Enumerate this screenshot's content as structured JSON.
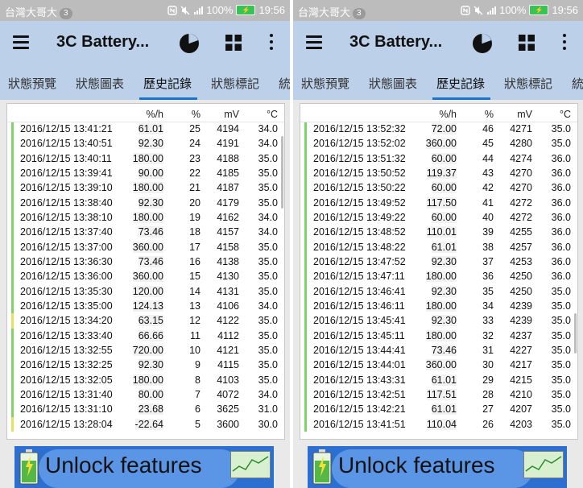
{
  "statusbar": {
    "carrier": "台灣大哥大",
    "notification_count": "3",
    "battery": "100%",
    "time": "19:56"
  },
  "app": {
    "title": "3C Battery...",
    "accent": "#1a73c8",
    "appbar_color": "#bcd0ea"
  },
  "tabs": [
    {
      "label": "狀態預覽",
      "active": false
    },
    {
      "label": "狀態圖表",
      "active": false
    },
    {
      "label": "歷史記錄",
      "active": true
    },
    {
      "label": "狀態標記",
      "active": false
    },
    {
      "label": "統",
      "active": false
    }
  ],
  "table": {
    "columns": [
      "",
      "%/h",
      "%",
      "mV",
      "°C"
    ]
  },
  "left_rows": [
    [
      "2016/12/15 13:41:21",
      "61.01",
      "25",
      "4194",
      "34.0"
    ],
    [
      "2016/12/15 13:40:51",
      "92.30",
      "24",
      "4191",
      "34.0"
    ],
    [
      "2016/12/15 13:40:11",
      "180.00",
      "23",
      "4188",
      "35.0"
    ],
    [
      "2016/12/15 13:39:41",
      "90.00",
      "22",
      "4185",
      "35.0"
    ],
    [
      "2016/12/15 13:39:10",
      "180.00",
      "21",
      "4187",
      "35.0"
    ],
    [
      "2016/12/15 13:38:40",
      "92.30",
      "20",
      "4179",
      "35.0"
    ],
    [
      "2016/12/15 13:38:10",
      "180.00",
      "19",
      "4162",
      "34.0"
    ],
    [
      "2016/12/15 13:37:40",
      "73.46",
      "18",
      "4157",
      "34.0"
    ],
    [
      "2016/12/15 13:37:00",
      "360.00",
      "17",
      "4158",
      "35.0"
    ],
    [
      "2016/12/15 13:36:30",
      "73.46",
      "16",
      "4138",
      "35.0"
    ],
    [
      "2016/12/15 13:36:00",
      "360.00",
      "15",
      "4130",
      "35.0"
    ],
    [
      "2016/12/15 13:35:30",
      "120.00",
      "14",
      "4131",
      "35.0"
    ],
    [
      "2016/12/15 13:35:00",
      "124.13",
      "13",
      "4106",
      "34.0"
    ],
    [
      "2016/12/15 13:34:20",
      "63.15",
      "12",
      "4122",
      "35.0"
    ],
    [
      "2016/12/15 13:33:40",
      "66.66",
      "11",
      "4112",
      "35.0"
    ],
    [
      "2016/12/15 13:32:55",
      "720.00",
      "10",
      "4121",
      "35.0"
    ],
    [
      "2016/12/15 13:32:25",
      "92.30",
      "9",
      "4115",
      "35.0"
    ],
    [
      "2016/12/15 13:32:05",
      "180.00",
      "8",
      "4103",
      "35.0"
    ],
    [
      "2016/12/15 13:31:40",
      "80.00",
      "7",
      "4072",
      "34.0"
    ],
    [
      "2016/12/15 13:31:10",
      "23.68",
      "6",
      "3625",
      "31.0"
    ],
    [
      "2016/12/15 13:28:04",
      "-22.64",
      "5",
      "3600",
      "30.0"
    ]
  ],
  "right_rows": [
    [
      "2016/12/15 13:52:32",
      "72.00",
      "46",
      "4271",
      "35.0"
    ],
    [
      "2016/12/15 13:52:02",
      "360.00",
      "45",
      "4280",
      "35.0"
    ],
    [
      "2016/12/15 13:51:32",
      "60.00",
      "44",
      "4274",
      "36.0"
    ],
    [
      "2016/12/15 13:50:52",
      "119.37",
      "43",
      "4270",
      "36.0"
    ],
    [
      "2016/12/15 13:50:22",
      "60.00",
      "42",
      "4270",
      "36.0"
    ],
    [
      "2016/12/15 13:49:52",
      "117.50",
      "41",
      "4272",
      "36.0"
    ],
    [
      "2016/12/15 13:49:22",
      "60.00",
      "40",
      "4272",
      "36.0"
    ],
    [
      "2016/12/15 13:48:52",
      "110.01",
      "39",
      "4255",
      "36.0"
    ],
    [
      "2016/12/15 13:48:22",
      "61.01",
      "38",
      "4257",
      "36.0"
    ],
    [
      "2016/12/15 13:47:52",
      "92.30",
      "37",
      "4253",
      "36.0"
    ],
    [
      "2016/12/15 13:47:11",
      "180.00",
      "36",
      "4250",
      "36.0"
    ],
    [
      "2016/12/15 13:46:41",
      "92.30",
      "35",
      "4250",
      "35.0"
    ],
    [
      "2016/12/15 13:46:11",
      "180.00",
      "34",
      "4239",
      "35.0"
    ],
    [
      "2016/12/15 13:45:41",
      "92.30",
      "33",
      "4239",
      "35.0"
    ],
    [
      "2016/12/15 13:45:11",
      "180.00",
      "32",
      "4237",
      "35.0"
    ],
    [
      "2016/12/15 13:44:41",
      "73.46",
      "31",
      "4227",
      "35.0"
    ],
    [
      "2016/12/15 13:44:01",
      "360.00",
      "30",
      "4217",
      "35.0"
    ],
    [
      "2016/12/15 13:43:31",
      "61.01",
      "29",
      "4215",
      "35.0"
    ],
    [
      "2016/12/15 13:42:51",
      "117.51",
      "28",
      "4210",
      "35.0"
    ],
    [
      "2016/12/15 13:42:21",
      "61.01",
      "27",
      "4207",
      "35.0"
    ],
    [
      "2016/12/15 13:41:51",
      "110.04",
      "26",
      "4203",
      "35.0"
    ]
  ],
  "banner": {
    "text": "Unlock features"
  }
}
